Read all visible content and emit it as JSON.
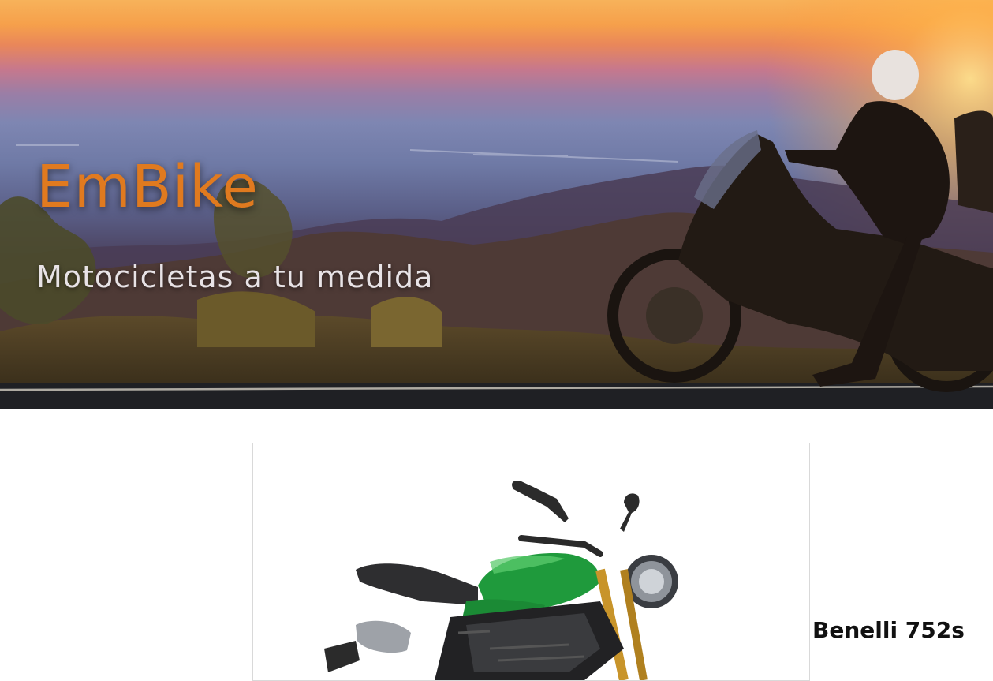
{
  "header": {
    "brand": "EmBike",
    "tagline": "Motocicletas a tu medida",
    "brand_color": "#e07a1f",
    "background_image": "sunset-motorcycle-rider-photo"
  },
  "products": [
    {
      "name": "Benelli 752s",
      "image": "green-naked-motorcycle-photo",
      "accent_color": "#1f9a3c"
    }
  ]
}
